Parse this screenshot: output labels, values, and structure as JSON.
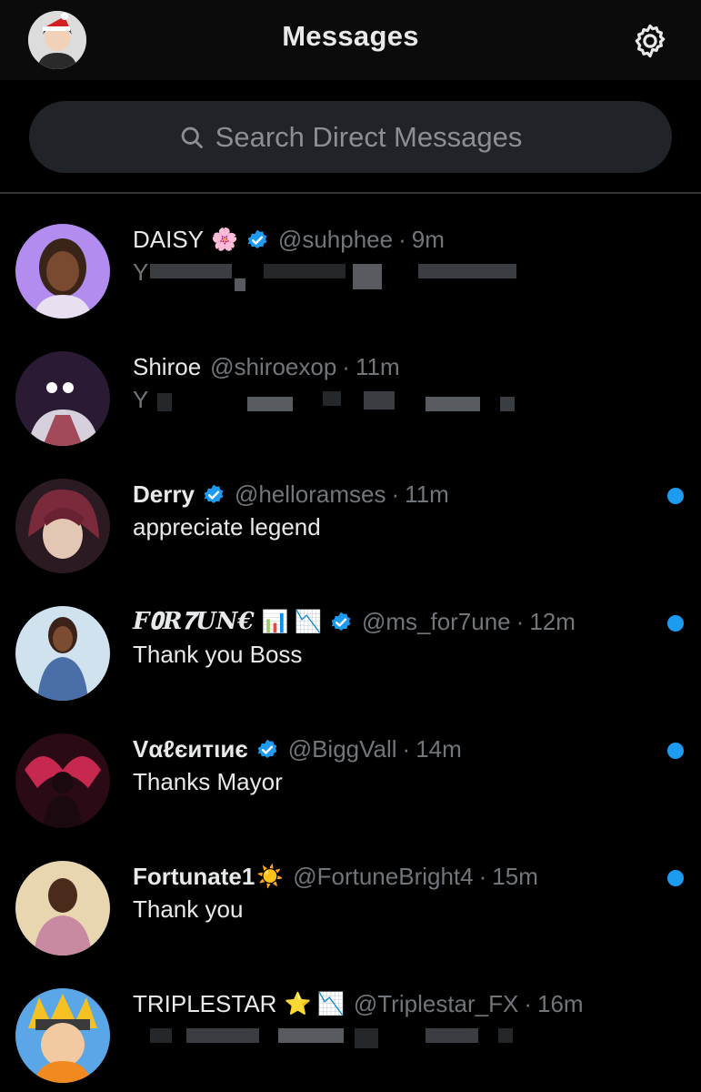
{
  "header": {
    "title": "Messages",
    "avatar_icon": "user-avatar-icon",
    "settings_icon": "gear-icon"
  },
  "search": {
    "placeholder": "Search Direct Messages",
    "icon": "search-icon"
  },
  "conversations": [
    {
      "name": "DAISY",
      "emoji": "🌸",
      "verified": true,
      "handle": "@suhphee",
      "separator": "·",
      "time": "9m",
      "preview": "Y",
      "preview_blurred": true,
      "unread": false
    },
    {
      "name": "Shiroe",
      "emoji": "",
      "verified": false,
      "handle": "@shiroexop",
      "separator": "·",
      "time": "11m",
      "preview": "Y",
      "preview_blurred": true,
      "unread": false
    },
    {
      "name": "Derry",
      "emoji": "",
      "verified": true,
      "handle": "@helloramses",
      "separator": "·",
      "time": "11m",
      "preview": "appreciate legend",
      "preview_blurred": false,
      "unread": true
    },
    {
      "name": "𝑭𝟎𝑹𝟕𝑼𝑵€",
      "emoji": "📊 📉",
      "verified": true,
      "handle": "@ms_for7une",
      "separator": "·",
      "time": "12m",
      "preview": "Thank you Boss",
      "preview_blurred": false,
      "unread": true
    },
    {
      "name": "Vαℓєитιиє",
      "emoji": "",
      "verified": true,
      "handle": "@BiggVall",
      "separator": "·",
      "time": "14m",
      "preview": "Thanks Mayor",
      "preview_blurred": false,
      "unread": true
    },
    {
      "name": "Fortunate1",
      "emoji": "☀️",
      "verified": false,
      "handle": "@FortuneBright4",
      "separator": "·",
      "time": "15m",
      "preview": "Thank you",
      "preview_blurred": false,
      "unread": true
    },
    {
      "name": "TRIPLESTAR",
      "emoji": "⭐ 📉",
      "verified": false,
      "handle": "@Triplestar_FX",
      "separator": "·",
      "time": "16m",
      "preview": "",
      "preview_blurred": true,
      "unread": false
    }
  ],
  "colors": {
    "background": "#000000",
    "accent": "#1d9bf0",
    "muted_text": "#71767b",
    "primary_text": "#e7e9ea",
    "search_bg": "#202327"
  }
}
